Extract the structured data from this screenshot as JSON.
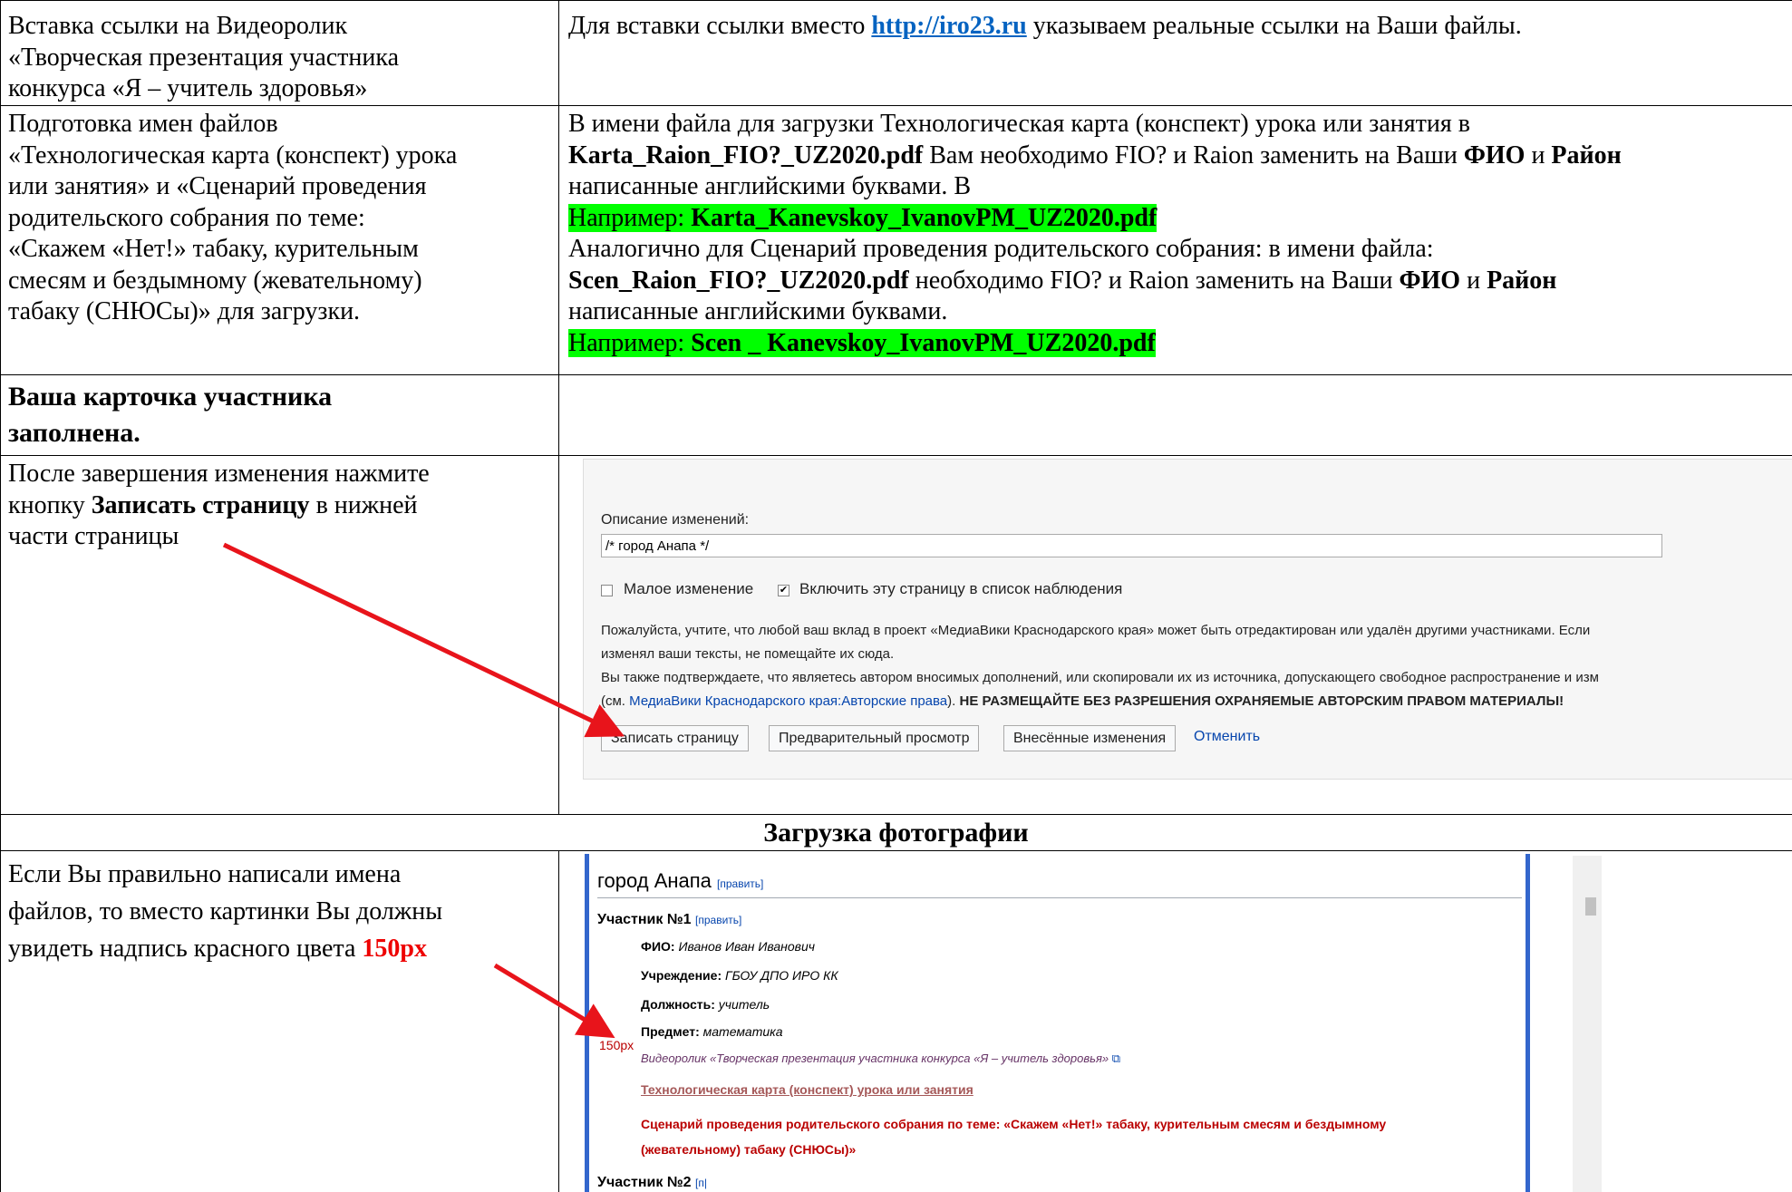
{
  "rows": {
    "r1": {
      "left": [
        "Вставка ссылки на Видеоролик",
        "«Творческая презентация участника",
        "конкурса «Я – учитель здоровья»"
      ],
      "right_pre": "Для вставки ссылки вместо ",
      "right_link": "http://iro23.ru",
      "right_post": " указываем реальные ссылки на Ваши файлы."
    },
    "r2": {
      "left": [
        "Подготовка имен файлов",
        "«Технологическая карта (конспект) урока",
        "или занятия» и «Сценарий проведения",
        "родительского собрания по теме:",
        "«Скажем «Нет!» табаку, курительным",
        "смесям и бездымному (жевательному)",
        "табаку (СНЮСы)» для загрузки."
      ],
      "p1": "В имени файла для загрузки Технологическая карта (конспект) урока или занятия в",
      "p2_bold": "Karta_Raion_FIO?_UZ2020.pdf",
      "p2_mid": " Вам необходимо FIO? и Raion заменить на Ваши ",
      "fio": "ФИО",
      "and": " и ",
      "raion": "Район",
      "p3": "написанные английскими буквами.  В",
      "ex1_label": "Например: ",
      "ex1_value": "Karta_Kanevskoy_IvanovPM_UZ2020.pdf",
      "p4": "Аналогично для Сценарий проведения родительского собрания: в имени файла:",
      "p5_bold": "Scen_Raion_FIO?_UZ2020.pdf",
      "p5_mid": " необходимо FIO? и Raion заменить на Ваши ",
      "p6": "написанные английскими буквами.",
      "ex2_label": "Например: ",
      "ex2_value": "Scen _ Kanevskoy_IvanovPM_UZ2020.pdf"
    },
    "r3": {
      "left": [
        "Ваша карточка участника",
        "заполнена."
      ]
    },
    "r4": {
      "left_1": "После завершения изменения нажмите",
      "left_2_pre": "кнопку ",
      "left_2_bold": "Записать страницу",
      "left_2_post": " в нижней",
      "left_3": "части страницы"
    },
    "r5": {
      "heading": "Загрузка фотографии"
    },
    "r6": {
      "left_1": "Если Вы правильно написали имена",
      "left_2": "файлов, то вместо картинки Вы должны",
      "left_3_pre": "увидеть надпись красного цвета ",
      "left_3_red": "150px"
    }
  },
  "edit_form": {
    "summary_label": "Описание изменений:",
    "summary_value": "/* город Анапа */",
    "minor_edit": "Малое изменение",
    "watch": "Включить эту страницу в список наблюдения",
    "notice1": "Пожалуйста, учтите, что любой ваш вклад в проект «МедиаВики Краснодарского края» может быть отредактирован или удалён другими участниками. Если",
    "notice2": "изменял ваши тексты, не помещайте их сюда.",
    "notice3": "Вы также подтверждаете, что являетесь автором вносимых дополнений, или скопировали их из источника, допускающего свободное распространение и изм",
    "notice4_pre": "(см. ",
    "notice4_link": "МедиаВики Краснодарского края:Авторские права",
    "notice4_post": "). ",
    "notice4_bold": "НЕ РАЗМЕЩАЙТЕ БЕЗ РАЗРЕШЕНИЯ ОХРАНЯЕМЫЕ АВТОРСКИМ ПРАВОМ МАТЕРИАЛЫ!",
    "save_button": "Записать страницу",
    "preview_button": "Предварительный просмотр",
    "diff_button": "Внесённые изменения",
    "cancel_link": "Отменить"
  },
  "wiki_page": {
    "heading": "город Анапа",
    "edit": "[править]",
    "participant1": "Участник №1",
    "fio_label": "ФИО:",
    "fio_value": "Иванов Иван Иванович",
    "inst_label": "Учреждение:",
    "inst_value": "ГБОУ ДПО ИРО КК",
    "pos_label": "Должность:",
    "pos_value": "учитель",
    "subj_label": "Предмет:",
    "subj_value": "математика",
    "px_label": "150px",
    "video_link": "Видеоролик «Творческая презентация участника конкурса «Я – учитель здоровья»",
    "tech_link": "Технологическая карта (конспект) урока или занятия",
    "scen_line1": "Сценарий проведения родительского собрания по теме: «Скажем «Нет!» табаку, курительным смесям и бездымному",
    "scen_line2": "(жевательному) табаку (СНЮСы)»",
    "participant2": "Участник №2",
    "edit2": "[п|"
  },
  "colors": {
    "highlight": "#00ff00",
    "arrow": "#e8141b",
    "link": "#0563c1",
    "wiki_link": "#0645ad",
    "red_link": "#ba0000",
    "wiki_bar": "#3366cc"
  }
}
